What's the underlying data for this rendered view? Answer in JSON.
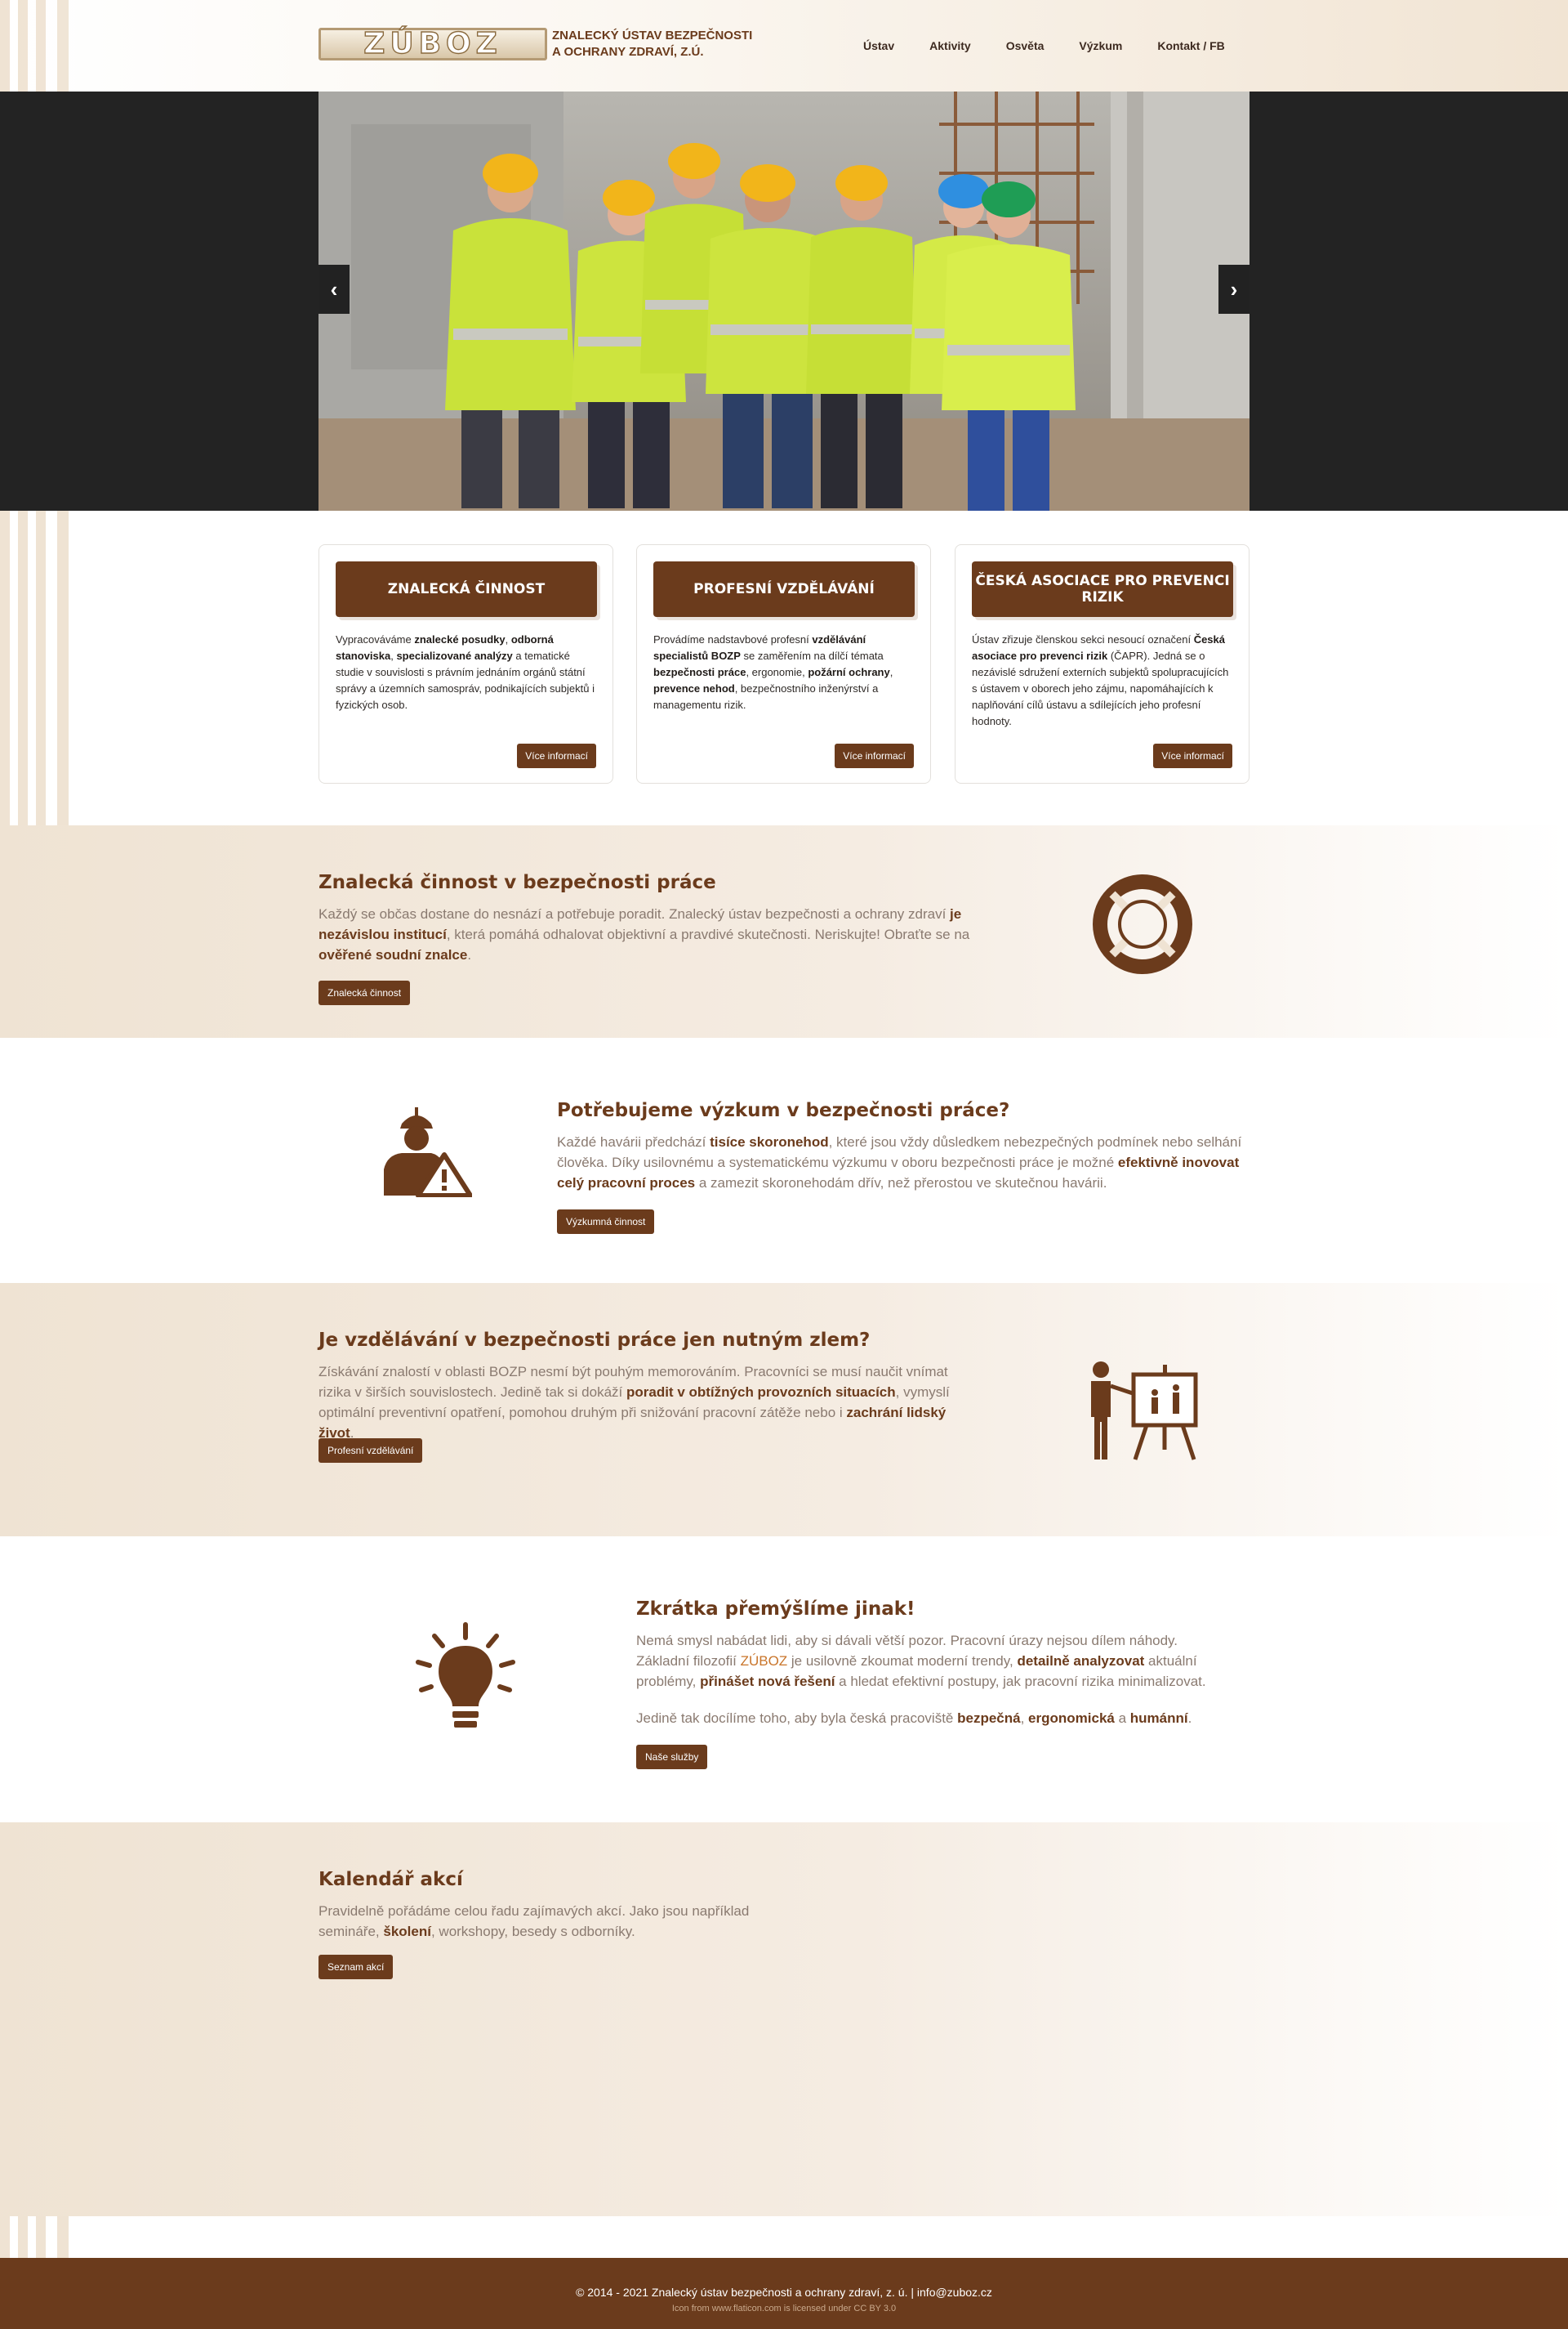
{
  "header": {
    "logo_word": "ZÚBOZ",
    "org_line1": "ZNALECKÝ ÚSTAV BEZPEČNOSTI",
    "org_line2": "A OCHRANY ZDRAVÍ, z.ú.",
    "nav": [
      "Ústav",
      "Aktivity",
      "Osvěta",
      "Výzkum",
      "Kontakt / FB"
    ]
  },
  "slider": {
    "prev_icon": "‹",
    "next_icon": "›"
  },
  "cards": [
    {
      "title": "ZNALECKÁ ČINNOST",
      "text": [
        {
          "t": "Vypracováváme "
        },
        {
          "t": "znalecké posudky",
          "b": true
        },
        {
          "t": ", "
        },
        {
          "t": "odborná stanoviska",
          "b": true
        },
        {
          "t": ", "
        },
        {
          "t": "specializované analýzy",
          "b": true
        },
        {
          "t": " a tematické studie v souvislosti s právním jednáním orgánů státní správy a územních samospráv, podnikajících subjektů i fyzických osob."
        }
      ],
      "button": "Více informací"
    },
    {
      "title": "PROFESNÍ VZDĚLÁVÁNÍ",
      "text": [
        {
          "t": "Provádíme nadstavbové profesní "
        },
        {
          "t": "vzdělávání specialistů BOZP",
          "b": true
        },
        {
          "t": " se zaměřením na dílčí témata "
        },
        {
          "t": "bezpečnosti práce",
          "b": true
        },
        {
          "t": ", ergonomie, "
        },
        {
          "t": "požární ochrany",
          "b": true
        },
        {
          "t": ", "
        },
        {
          "t": "prevence nehod",
          "b": true
        },
        {
          "t": ", bezpečnostního inženýrství a managementu rizik."
        }
      ],
      "button": "Více informací"
    },
    {
      "title": "ČESKÁ ASOCIACE PRO PREVENCI RIZIK",
      "text": [
        {
          "t": "Ústav zřizuje členskou sekci nesoucí označení "
        },
        {
          "t": "Česká asociace pro prevenci rizik",
          "b": true
        },
        {
          "t": " (ČAPR). Jedná se o nezávislé sdružení externích subjektů spolupracujících s ústavem v oborech jeho zájmu, napomáhajících k naplňování cílů ústavu a sdílejících jeho profesní hodnoty."
        }
      ],
      "button": "Více informací"
    }
  ],
  "sections": {
    "expert": {
      "title": "Znalecká činnost v bezpečnosti práce",
      "text": [
        {
          "t": "Každý se občas dostane do nesnází a potřebuje poradit. Znalecký ústav bezpečnosti a ochrany zdraví "
        },
        {
          "t": "je nezávislou institucí",
          "b": true
        },
        {
          "t": ", která pomáhá odhalovat objektivní a pravdivé skutečnosti. Neriskujte! Obraťte se na "
        },
        {
          "t": "ověřené soudní znalce",
          "b": true
        },
        {
          "t": "."
        }
      ],
      "button": "Znalecká činnost",
      "icon": "lifebuoy-icon"
    },
    "research": {
      "title": "Potřebujeme výzkum v bezpečnosti práce?",
      "text": [
        {
          "t": "Každé havárii předchází "
        },
        {
          "t": "tisíce skoronehod",
          "b": true
        },
        {
          "t": ", které jsou vždy důsledkem nebezpečných podmínek nebo selhání člověka. Díky usilovnému a systematickému výzkumu v oboru bezpečnosti práce je možné "
        },
        {
          "t": "efektivně inovovat celý pracovní proces",
          "b": true
        },
        {
          "t": " a zamezit skoronehodám dřív, než přerostou ve skutečnou havárii."
        }
      ],
      "button": "Výzkumná činnost",
      "icon": "worker-warning-icon"
    },
    "education": {
      "title": "Je vzdělávání v bezpečnosti práce jen nutným zlem?",
      "text": [
        {
          "t": "Získávání znalostí v oblasti BOZP nesmí být pouhým memorováním. Pracovníci se musí naučit vnímat rizika v širších souvislostech. Jedině tak si dokáží "
        },
        {
          "t": "poradit v obtížných provozních situacích",
          "b": true
        },
        {
          "t": ", vymyslí optimální preventivní opatření, pomohou druhým při snižování pracovní zátěže nebo i "
        },
        {
          "t": "zachrání lidský život",
          "b": true
        },
        {
          "t": "."
        }
      ],
      "button": "Profesní vzdělávání",
      "icon": "presentation-icon"
    },
    "think": {
      "title": "Zkrátka přemýšlíme jinak!",
      "text": [
        {
          "t": "Nemá smysl nabádat lidi, aby si dávali větší pozor. Pracovní úrazy nejsou dílem náhody. Základní filozofií "
        },
        {
          "t": "ZÚBOZ",
          "accent": true
        },
        {
          "t": " je usilovně zkoumat moderní trendy, "
        },
        {
          "t": "detailně analyzovat",
          "b": true
        },
        {
          "t": " aktuální problémy, "
        },
        {
          "t": "přinášet nová řešení",
          "b": true
        },
        {
          "t": " a hledat efektivní postupy, jak pracovní rizika minimalizovat."
        }
      ],
      "text2": [
        {
          "t": "Jedině tak docílíme toho, aby byla česká pracoviště "
        },
        {
          "t": "bezpečná",
          "b": true
        },
        {
          "t": ", "
        },
        {
          "t": "ergonomická",
          "b": true
        },
        {
          "t": " a "
        },
        {
          "t": "humánní",
          "b": true
        },
        {
          "t": "."
        }
      ],
      "button": "Naše služby",
      "icon": "lightbulb-icon"
    },
    "calendar": {
      "title": "Kalendář akcí",
      "text": [
        {
          "t": "Pravidelně pořádáme celou řadu zajímavých akcí. Jako jsou například semináře, "
        },
        {
          "t": "školení",
          "b": true
        },
        {
          "t": ", workshopy, besedy s odborníky."
        }
      ],
      "button": "Seznam akcí"
    }
  },
  "footer": {
    "copyright": "© 2014 - 2021 Znalecký ústav bezpečnosti a ochrany zdraví, z. ú. | info@zuboz.cz",
    "credit": "Icon from www.flaticon.com is licensed under CC BY 3.0"
  },
  "colors": {
    "brand": "#6b3b1c",
    "tan": "#efe3d3",
    "accent": "#c9752b"
  }
}
